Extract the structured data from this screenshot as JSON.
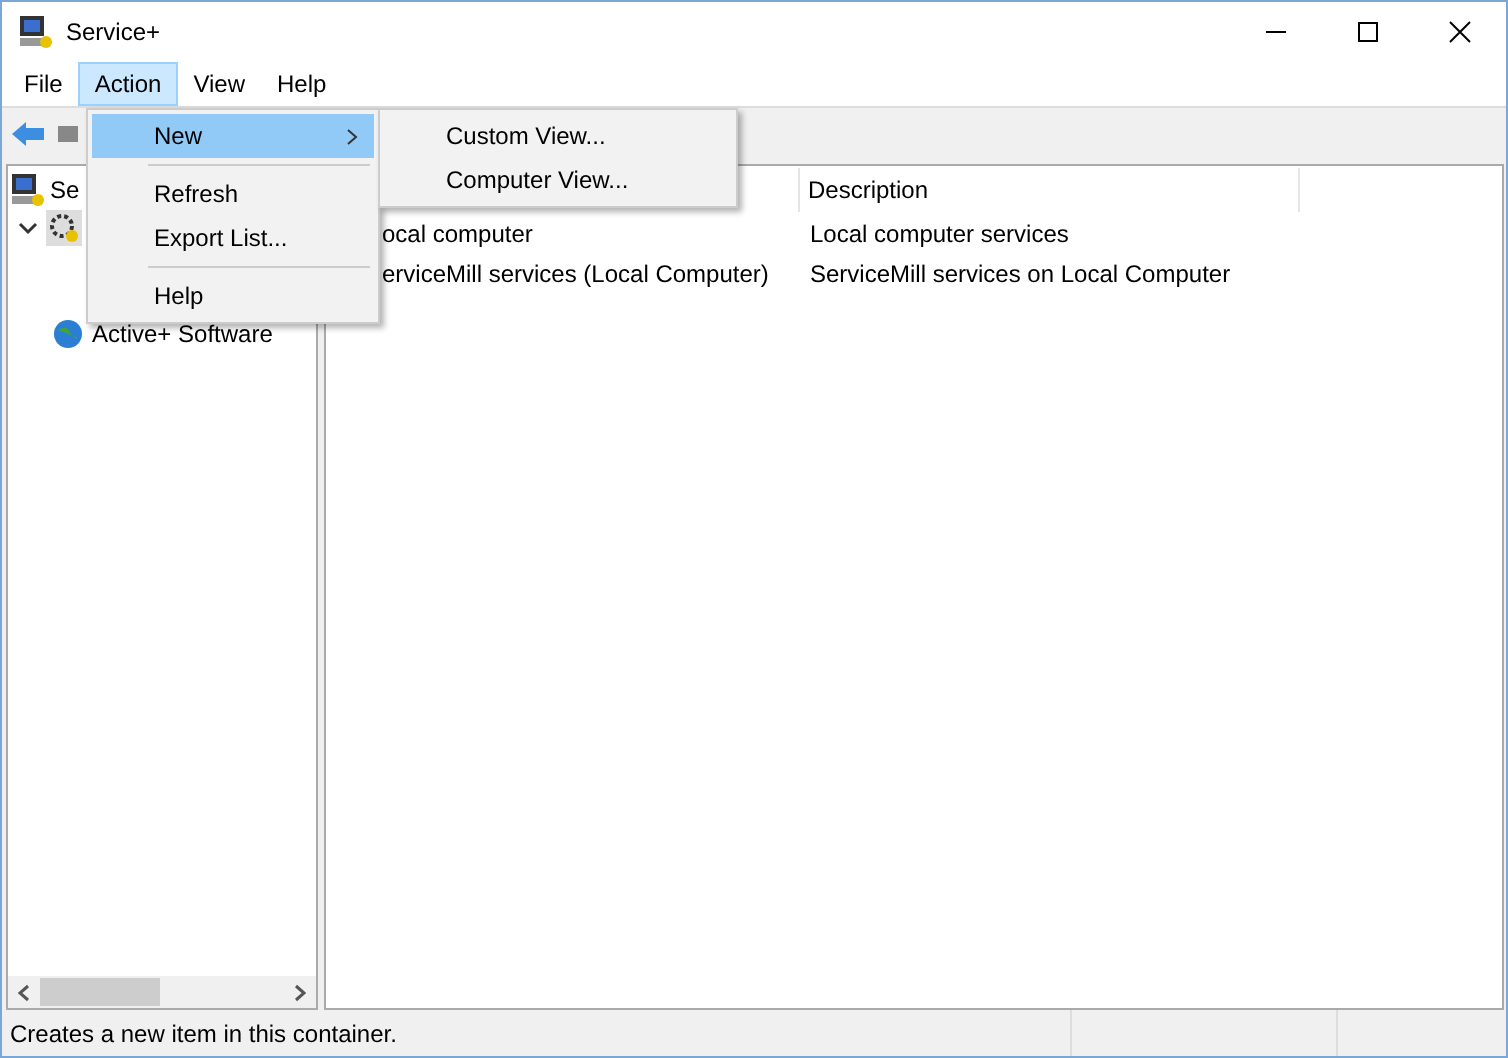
{
  "window": {
    "title": "Service+"
  },
  "menu_bar": [
    {
      "label": "File",
      "selected": false
    },
    {
      "label": "Action",
      "selected": true
    },
    {
      "label": "View",
      "selected": false
    },
    {
      "label": "Help",
      "selected": false
    }
  ],
  "action_menu": {
    "items": [
      {
        "label": "New",
        "kind": "submenu",
        "selected": true
      },
      {
        "kind": "separator"
      },
      {
        "label": "Refresh",
        "kind": "item",
        "selected": false
      },
      {
        "label": "Export List...",
        "kind": "item",
        "selected": false
      },
      {
        "kind": "separator"
      },
      {
        "label": "Help",
        "kind": "item",
        "selected": false
      }
    ]
  },
  "new_submenu": {
    "items": [
      {
        "label": "Custom View..."
      },
      {
        "label": "Computer View..."
      }
    ]
  },
  "tree": {
    "items": [
      {
        "label": "Se",
        "expanded": false
      },
      {
        "expanded": true
      },
      {
        "label": "Active+ Software",
        "expanded": false
      }
    ]
  },
  "table": {
    "columns": [
      "Description"
    ],
    "rows": [
      {
        "name": "ocal computer",
        "description": "Local computer services"
      },
      {
        "name": "erviceMill services (Local Computer)",
        "description": "ServiceMill services on Local Computer"
      }
    ]
  },
  "status_bar": {
    "text": "Creates a new item in this container."
  }
}
